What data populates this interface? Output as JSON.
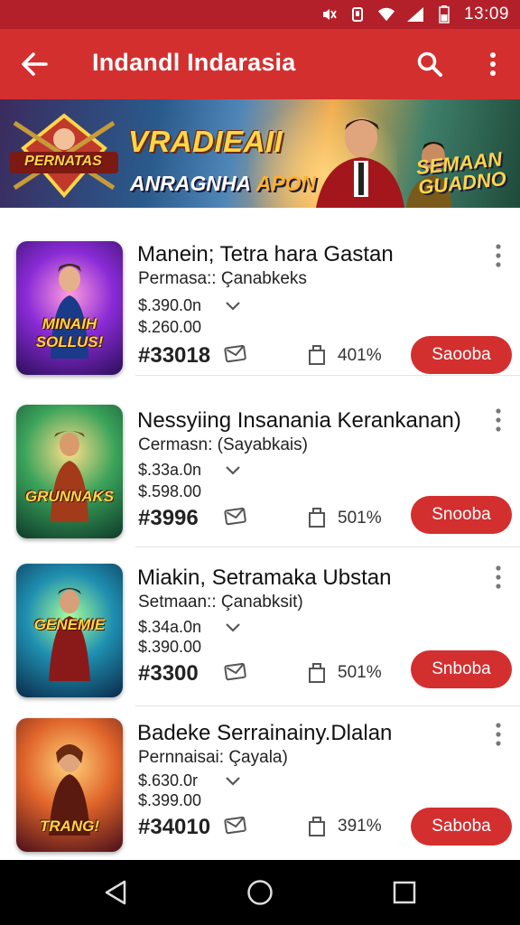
{
  "status_bar": {
    "time": "13:09"
  },
  "app_bar": {
    "title": "Indandl Indarasia"
  },
  "banner": {
    "headline": "VRADIEAII",
    "subline_white": "ANRAGNHA",
    "subline_orange": "APON",
    "logo_text": "PERNATAS",
    "side_text_1": "SEMAAN",
    "side_text_2": "GUADNO"
  },
  "items": [
    {
      "thumb_text": "MINAIH SOLLUS!",
      "title": "Manein; Tetra hara Gastan",
      "subtitle": "Permasa:: Çanabkeks",
      "price1": "$.390.0n",
      "price2": "$.260.00",
      "rank": "#33018",
      "percent": "401%",
      "button": "Saooba"
    },
    {
      "thumb_text": "GRUNNAKS",
      "title": "Nessyiing Insanania Kerankanan)",
      "subtitle": "Cermasn: (Sayabkais)",
      "price1": "$.33a.0n",
      "price2": "$.598.00",
      "rank": "#3996",
      "percent": "501%",
      "button": "Snooba"
    },
    {
      "thumb_text": "GENEMIE",
      "title": "Miakin, Setramaka Ubstan",
      "subtitle": "Setmaan:: Çanabksit)",
      "price1": "$.34a.0n",
      "price2": "$.390.00",
      "rank": "#3300",
      "percent": "501%",
      "button": "Snboba"
    },
    {
      "thumb_text": "TRANG!",
      "title": "Badeke Serrainainy.Dlalan",
      "subtitle": "Pernnaisai: Çayala)",
      "price1": "$.630.0r",
      "price2": "$.399.00",
      "rank": "#34010",
      "percent": "391%",
      "button": "Saboba"
    }
  ],
  "colors": {
    "primary": "#d32f2f",
    "status": "#b3202a"
  }
}
